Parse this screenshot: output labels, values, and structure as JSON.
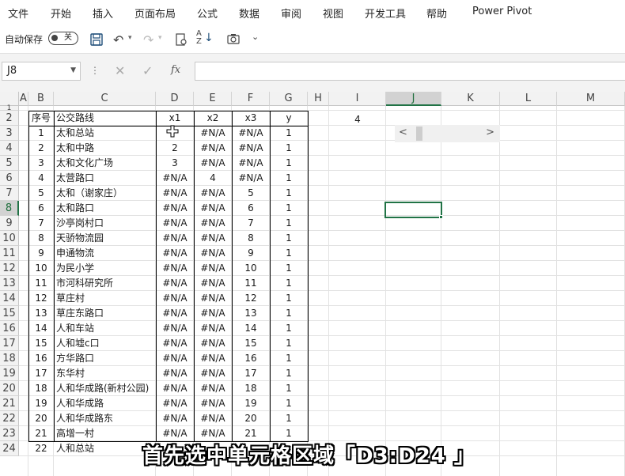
{
  "menu": [
    "文件",
    "开始",
    "插入",
    "页面布局",
    "公式",
    "数据",
    "审阅",
    "视图",
    "开发工具",
    "帮助",
    "Power Pivot"
  ],
  "qat": {
    "autosave_label": "自动保存",
    "autosave_state": "关"
  },
  "formula_bar": {
    "name_box": "J8",
    "fx": "fx",
    "formula": ""
  },
  "columns": [
    "A",
    "B",
    "C",
    "D",
    "E",
    "F",
    "G",
    "H",
    "I",
    "J",
    "K",
    "L",
    "M"
  ],
  "selected_cell": "J8",
  "rows": [
    "1",
    "2",
    "3",
    "4",
    "5",
    "6",
    "7",
    "8",
    "9",
    "10",
    "11",
    "12",
    "13",
    "14",
    "15",
    "16",
    "17",
    "18",
    "19",
    "20",
    "21",
    "22",
    "23",
    "24"
  ],
  "table": {
    "headers": [
      "序号",
      "公交路线",
      "x1",
      "x2",
      "x3",
      "y"
    ],
    "rows": [
      [
        "1",
        "太和总站",
        "",
        "#N/A",
        "#N/A",
        "1"
      ],
      [
        "2",
        "太和中路",
        "2",
        "#N/A",
        "#N/A",
        "1"
      ],
      [
        "3",
        "太和文化广场",
        "3",
        "#N/A",
        "#N/A",
        "1"
      ],
      [
        "4",
        "太营路口",
        "#N/A",
        "4",
        "#N/A",
        "1"
      ],
      [
        "5",
        "太和（谢家庄）",
        "#N/A",
        "#N/A",
        "5",
        "1"
      ],
      [
        "6",
        "太和路口",
        "#N/A",
        "#N/A",
        "6",
        "1"
      ],
      [
        "7",
        "沙亭岗村口",
        "#N/A",
        "#N/A",
        "7",
        "1"
      ],
      [
        "8",
        "天骄物流园",
        "#N/A",
        "#N/A",
        "8",
        "1"
      ],
      [
        "9",
        "申通物流",
        "#N/A",
        "#N/A",
        "9",
        "1"
      ],
      [
        "10",
        "为民小学",
        "#N/A",
        "#N/A",
        "10",
        "1"
      ],
      [
        "11",
        "市河科研究所",
        "#N/A",
        "#N/A",
        "11",
        "1"
      ],
      [
        "12",
        "草庄村",
        "#N/A",
        "#N/A",
        "12",
        "1"
      ],
      [
        "13",
        "草庄东路口",
        "#N/A",
        "#N/A",
        "13",
        "1"
      ],
      [
        "14",
        "人和车站",
        "#N/A",
        "#N/A",
        "14",
        "1"
      ],
      [
        "15",
        "人和墟c口",
        "#N/A",
        "#N/A",
        "15",
        "1"
      ],
      [
        "16",
        "方华路口",
        "#N/A",
        "#N/A",
        "16",
        "1"
      ],
      [
        "17",
        "东华村",
        "#N/A",
        "#N/A",
        "17",
        "1"
      ],
      [
        "18",
        "人和华成路(新村公园)",
        "#N/A",
        "#N/A",
        "18",
        "1"
      ],
      [
        "19",
        "人和华成路",
        "#N/A",
        "#N/A",
        "19",
        "1"
      ],
      [
        "20",
        "人和华成路东",
        "#N/A",
        "#N/A",
        "20",
        "1"
      ],
      [
        "21",
        "高增一村",
        "#N/A",
        "#N/A",
        "21",
        "1"
      ],
      [
        "22",
        "人和总站",
        "",
        "",
        "",
        ""
      ]
    ]
  },
  "i2_value": "4",
  "scrollbar": {
    "value": 4,
    "min": 1,
    "max": 22
  },
  "subtitle": "首先选中单元格区域「D3:D24 」",
  "colors": {
    "accent": "#217346",
    "header_bg": "#f2f2f2",
    "selected_header": "#d2d2d2"
  }
}
